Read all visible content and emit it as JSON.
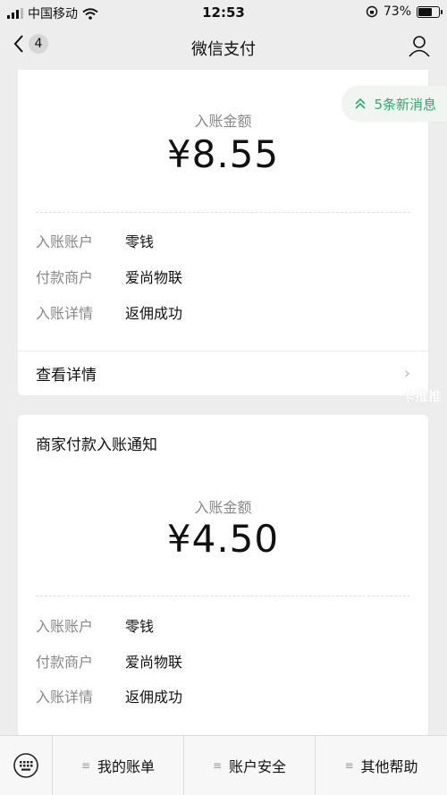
{
  "status": {
    "carrier": "中国移动",
    "time": "12:53",
    "battery": "73%",
    "battery_level": 0.73
  },
  "nav": {
    "back_badge": "4",
    "title": "微信支付",
    "back_icon": "chevron-left-icon",
    "user_icon": "user-icon"
  },
  "new_messages": "5条新消息",
  "card1": {
    "amount_label": "入账金额",
    "amount": "¥8.55",
    "rows": [
      {
        "k": "入账账户",
        "v": "零钱"
      },
      {
        "k": "付款商户",
        "v": "爱尚物联"
      },
      {
        "k": "入账详情",
        "v": "返佣成功"
      }
    ],
    "detail": "查看详情"
  },
  "watermark": "卡推推",
  "card2": {
    "title": "商家付款入账通知",
    "amount_label": "入账金额",
    "amount": "¥4.50",
    "rows": [
      {
        "k": "入账账户",
        "v": "零钱"
      },
      {
        "k": "付款商户",
        "v": "爱尚物联"
      },
      {
        "k": "入账详情",
        "v": "返佣成功"
      }
    ]
  },
  "bottom": {
    "tabs": [
      "我的账单",
      "账户安全",
      "其他帮助"
    ]
  },
  "colors": {
    "accent": "#2aae67",
    "background": "#ededed"
  }
}
